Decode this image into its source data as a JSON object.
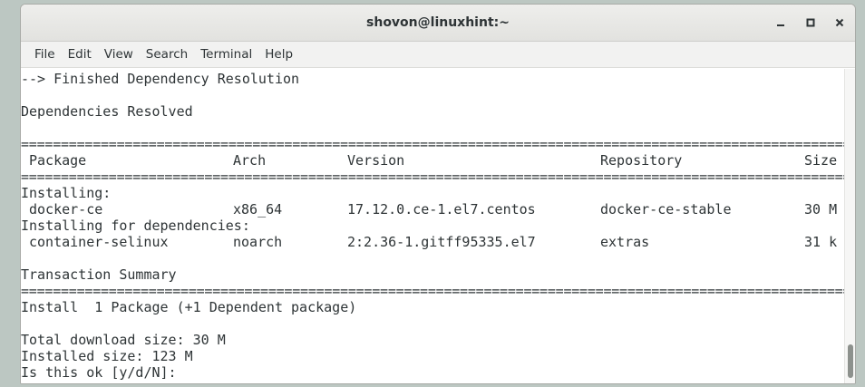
{
  "window": {
    "title": "shovon@linuxhint:~"
  },
  "menu": [
    "File",
    "Edit",
    "View",
    "Search",
    "Terminal",
    "Help"
  ],
  "terminal": {
    "lines": [
      "--> Finished Dependency Resolution",
      "",
      "Dependencies Resolved",
      "",
      "=========================================================================================================",
      "",
      "=========================================================================================================",
      "Installing:",
      "",
      "Installing for dependencies:",
      "",
      "",
      "Transaction Summary",
      "=========================================================================================================",
      "Install  1 Package (+1 Dependent package)",
      "",
      "Total download size: 30 M",
      "Installed size: 123 M",
      "Is this ok [y/d/N]: "
    ],
    "table": {
      "header": {
        "package": "Package",
        "arch": "Arch",
        "version": "Version",
        "repository": "Repository",
        "size": "Size"
      },
      "installing": {
        "package": "docker-ce",
        "arch": "x86_64",
        "version": "17.12.0.ce-1.el7.centos",
        "repository": "docker-ce-stable",
        "size": "30 M"
      },
      "dependency": {
        "package": "container-selinux",
        "arch": "noarch",
        "version": "2:2.36-1.gitff95335.el7",
        "repository": "extras",
        "size": "31 k"
      }
    }
  },
  "colors": {
    "background": "#bcc7c2",
    "terminal_bg": "#ffffff",
    "terminal_fg": "#2e3436",
    "titlebar": "#e8e8e6"
  },
  "icons": [
    "minimize-icon",
    "maximize-icon",
    "close-icon"
  ]
}
